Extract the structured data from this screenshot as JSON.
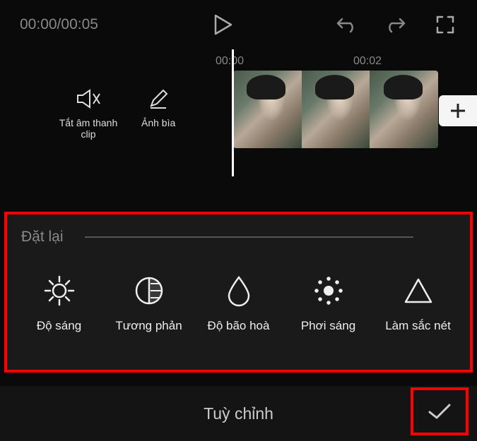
{
  "topbar": {
    "timecode": "00:00/00:05"
  },
  "timeline": {
    "label_0": "00:00",
    "label_2": "00:02"
  },
  "controls": {
    "mute_label": "Tắt âm thanh clip",
    "cover_label": "Ảnh bìa"
  },
  "add_button": "+",
  "adjust": {
    "reset_label": "Đặt lại",
    "items": [
      {
        "label": "Độ sáng"
      },
      {
        "label": "Tương phản"
      },
      {
        "label": "Độ bão hoà"
      },
      {
        "label": "Phơi sáng"
      },
      {
        "label": "Làm sắc nét"
      }
    ]
  },
  "bottom": {
    "title": "Tuỳ chỉnh"
  }
}
